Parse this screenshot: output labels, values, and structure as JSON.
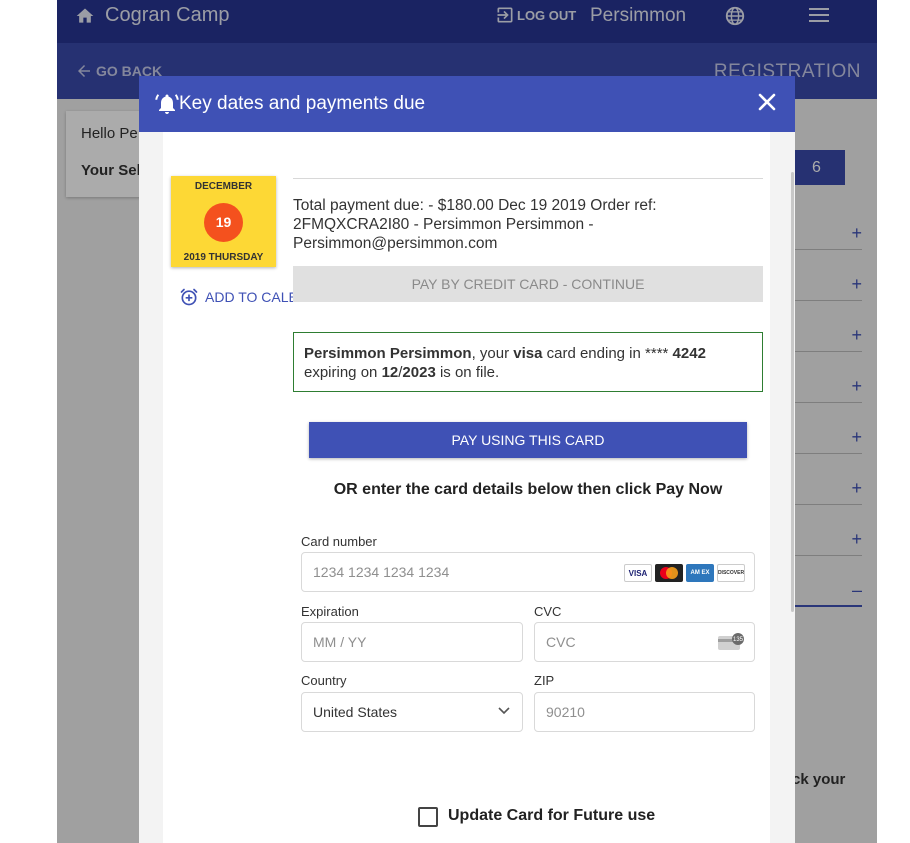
{
  "topbar": {
    "title": "Cogran Camp",
    "logout_label": "LOG OUT",
    "user_name": "Persimmon"
  },
  "subbar": {
    "back_label": "GO BACK",
    "page_label": "REGISTRATION"
  },
  "background": {
    "hello": "Hello Pe",
    "your_sel": "Your Sel",
    "badge_number": "6",
    "row_icons": [
      "+",
      "+",
      "+",
      "+",
      "+",
      "+",
      "+",
      "–"
    ],
    "right_text": "ck your"
  },
  "modal": {
    "title": "Key dates and payments due",
    "calendar": {
      "month": "DECEMBER",
      "day": "19",
      "year_weekday": "2019 THURSDAY"
    },
    "add_calendar_label": "ADD TO CALENDAR",
    "payment_text": "Total payment due: - $180.00 Dec 19 2019 Order ref: 2FMQXCRA2I80 - Persimmon Persimmon - Persimmon@persimmon.com",
    "pay_cc_label": "PAY BY CREDIT CARD - CONTINUE",
    "card_on_file": {
      "name": "Persimmon Persimmon",
      "t1": ", your ",
      "brand": "visa",
      "t2": " card ending in **** ",
      "last4": "4242",
      "t3": "expiring on ",
      "exp_month": "12",
      "slash": "/",
      "exp_year": "2023",
      "t4": " is on file."
    },
    "pay_card_label": "PAY USING THIS CARD",
    "or_text": "OR enter the card details below then click Pay Now",
    "form": {
      "card_number_label": "Card number",
      "card_number_placeholder": "1234 1234 1234 1234",
      "card_brands": [
        "VISA",
        "",
        "AM EX",
        "DISCOVER"
      ],
      "expiration_label": "Expiration",
      "expiration_placeholder": "MM / YY",
      "cvc_label": "CVC",
      "cvc_placeholder": "CVC",
      "cvc_badge": "135",
      "country_label": "Country",
      "country_value": "United States",
      "zip_label": "ZIP",
      "zip_value": "90210"
    },
    "update_card_label": "Update Card for Future use"
  },
  "colors": {
    "topbar": "#283593",
    "subbar": "#3949ab",
    "modal_header": "#3f51b5",
    "primary_button": "#3f51b5",
    "calendar": "#fdd835",
    "calendar_day": "#f4511e",
    "on_file_border": "#2e7d32"
  }
}
